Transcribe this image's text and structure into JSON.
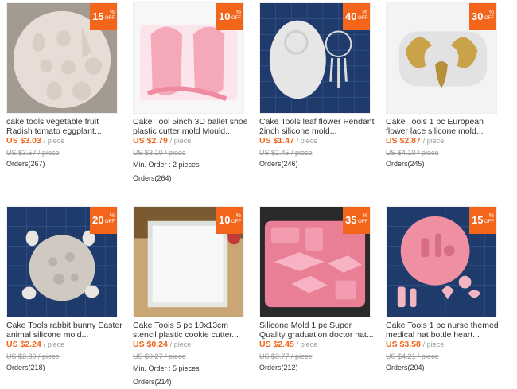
{
  "products": [
    {
      "discount": "15",
      "pct": "%",
      "off": "OFF",
      "title": "cake tools vegetable fruit Radish tomato eggplant...",
      "price": "US $3.03",
      "unit": "/ piece",
      "orig": "US $3.57 / piece",
      "min_order": "",
      "orders": "Orders(267)",
      "bg": "#9a9288",
      "fg": "#e8ddd6",
      "icon": "vegetable-mold-photo"
    },
    {
      "discount": "10",
      "pct": "%",
      "off": "OFF",
      "title": "Cake Tool 5inch 3D ballet shoe plastic cutter mold Mould...",
      "price": "US $2.79",
      "unit": "/ piece",
      "orig": "US $3.10 / piece",
      "min_order": "Min. Order : 2 pieces",
      "orders": "Orders(264)",
      "bg": "#f4f4f4",
      "fg": "#f5a9b8",
      "icon": "ballet-shoe-photo"
    },
    {
      "discount": "40",
      "pct": "%",
      "off": "OFF",
      "title": "Cake Tools leaf flower Pendant 2inch silicone mold...",
      "price": "US $1.47",
      "unit": "/ piece",
      "orig": "US $2.45 / piece",
      "min_order": "",
      "orders": "Orders(246)",
      "bg": "#1f3b6b",
      "fg": "#e6e6e6",
      "icon": "dreamcatcher-photo"
    },
    {
      "discount": "30",
      "pct": "%",
      "off": "OFF",
      "title": "Cake Tools 1 pc European flower lace silicone mold...",
      "price": "US $2.87",
      "unit": "/ piece",
      "orig": "US $4.10 / piece",
      "min_order": "",
      "orders": "Orders(245)",
      "bg": "#eeeeee",
      "fg": "#c9a24a",
      "icon": "lace-mold-photo"
    },
    {
      "discount": "20",
      "pct": "%",
      "off": "OFF",
      "title": "Cake Tools rabbit bunny Easter animal silicone mold...",
      "price": "US $2.24",
      "unit": "/ piece",
      "orig": "US $2.80 / piece",
      "min_order": "",
      "orders": "Orders(218)",
      "bg": "#1f3b6b",
      "fg": "#d9d4ce",
      "icon": "bunny-mold-photo"
    },
    {
      "discount": "10",
      "pct": "%",
      "off": "OFF",
      "title": "Cake Tools 5 pc 10x13cm stencil plastic cookie cutter...",
      "price": "US $0.24",
      "unit": "/ piece",
      "orig": "US $0.27 / piece",
      "min_order": "Min. Order : 5 pieces",
      "orders": "Orders(214)",
      "bg": "#c9a673",
      "fg": "#e9eef0",
      "icon": "stencil-photo"
    },
    {
      "discount": "35",
      "pct": "%",
      "off": "OFF",
      "title": "Silicone Mold 1 pc Super Quality graduation doctor hat...",
      "price": "US $2.45",
      "unit": "/ piece",
      "orig": "US $3.77 / piece",
      "min_order": "",
      "orders": "Orders(212)",
      "bg": "#2a2a2a",
      "fg": "#e97f95",
      "icon": "graduation-mold-photo"
    },
    {
      "discount": "15",
      "pct": "%",
      "off": "OFF",
      "title": "Cake Tools 1 pc nurse themed medical hat bottle heart...",
      "price": "US $3.58",
      "unit": "/ piece",
      "orig": "US $4.21 / piece",
      "min_order": "",
      "orders": "Orders(204)",
      "bg": "#1f3b6b",
      "fg": "#ee8fa2",
      "icon": "nurse-mold-photo"
    }
  ]
}
